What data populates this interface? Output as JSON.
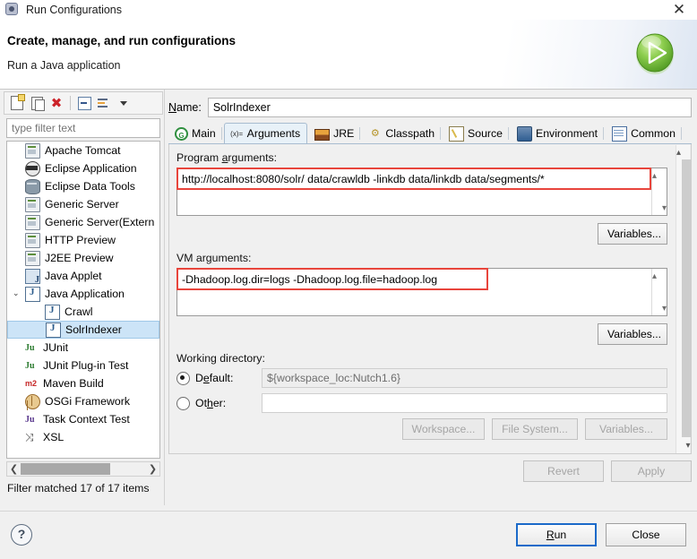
{
  "window": {
    "title": "Run Configurations",
    "icon": "run-configurations-icon",
    "close_label": "✕"
  },
  "header": {
    "title": "Create, manage, and run configurations",
    "subtitle": "Run a Java application",
    "run_icon": "run-play-icon"
  },
  "tree_toolbar": {
    "buttons": [
      {
        "name": "new-launch-configuration-button",
        "icon": "new-document-icon"
      },
      {
        "name": "duplicate-launch-configuration-button",
        "icon": "copy-icon"
      },
      {
        "name": "delete-launch-configuration-button",
        "icon": "delete-x-icon",
        "glyph": "✖"
      },
      {
        "name": "collapse-all-button",
        "icon": "collapse-all-icon"
      },
      {
        "name": "filter-launch-configurations-button",
        "icon": "filter-icon"
      },
      {
        "name": "view-menu-button",
        "icon": "chevron-down-icon"
      }
    ]
  },
  "filter": {
    "placeholder": "type filter text",
    "value": "",
    "status": "Filter matched 17 of 17 items"
  },
  "tree": {
    "items": [
      {
        "label": "Apache Tomcat",
        "icon": "server-icon",
        "indent": 0,
        "selected": false,
        "twisty": ""
      },
      {
        "label": "Eclipse Application",
        "icon": "eclipse-icon",
        "indent": 0,
        "selected": false,
        "twisty": ""
      },
      {
        "label": "Eclipse Data Tools",
        "icon": "database-icon",
        "indent": 0,
        "selected": false,
        "twisty": ""
      },
      {
        "label": "Generic Server",
        "icon": "server-icon",
        "indent": 0,
        "selected": false,
        "twisty": ""
      },
      {
        "label": "Generic Server(Extern",
        "icon": "server-icon",
        "indent": 0,
        "selected": false,
        "twisty": ""
      },
      {
        "label": "HTTP Preview",
        "icon": "server-icon",
        "indent": 0,
        "selected": false,
        "twisty": ""
      },
      {
        "label": "J2EE Preview",
        "icon": "server-icon",
        "indent": 0,
        "selected": false,
        "twisty": ""
      },
      {
        "label": "Java Applet",
        "icon": "java-applet-icon",
        "indent": 0,
        "selected": false,
        "twisty": ""
      },
      {
        "label": "Java Application",
        "icon": "java-application-icon",
        "indent": 0,
        "selected": false,
        "twisty": "⌄"
      },
      {
        "label": "Crawl",
        "icon": "java-application-icon",
        "indent": 1,
        "selected": false,
        "twisty": ""
      },
      {
        "label": "SolrIndexer",
        "icon": "java-application-icon",
        "indent": 1,
        "selected": true,
        "twisty": ""
      },
      {
        "label": "JUnit",
        "icon": "junit-icon",
        "indent": 0,
        "selected": false,
        "twisty": ""
      },
      {
        "label": "JUnit Plug-in Test",
        "icon": "junit-plugin-icon",
        "indent": 0,
        "selected": false,
        "twisty": ""
      },
      {
        "label": "Maven Build",
        "icon": "maven-icon",
        "indent": 0,
        "selected": false,
        "twisty": ""
      },
      {
        "label": "OSGi Framework",
        "icon": "osgi-icon",
        "indent": 0,
        "selected": false,
        "twisty": ""
      },
      {
        "label": "Task Context Test",
        "icon": "task-context-icon",
        "indent": 0,
        "selected": false,
        "twisty": ""
      },
      {
        "label": "XSL",
        "icon": "xsl-icon",
        "indent": 0,
        "selected": false,
        "twisty": ""
      }
    ]
  },
  "config": {
    "name_label": "Name:",
    "name_value": "SolrIndexer",
    "tabs": [
      {
        "label": "Main",
        "icon": "main-tab-icon",
        "active": false
      },
      {
        "label": "Arguments",
        "icon": "arguments-tab-icon",
        "active": true
      },
      {
        "label": "JRE",
        "icon": "jre-tab-icon",
        "active": false
      },
      {
        "label": "Classpath",
        "icon": "classpath-tab-icon",
        "active": false
      },
      {
        "label": "Source",
        "icon": "source-tab-icon",
        "active": false
      },
      {
        "label": "Environment",
        "icon": "environment-tab-icon",
        "active": false
      },
      {
        "label": "Common",
        "icon": "common-tab-icon",
        "active": false
      }
    ],
    "program_arguments": {
      "label": "Program arguments:",
      "value": "http://localhost:8080/solr/ data/crawldb -linkdb data/linkdb data/segments/*",
      "variables_button": "Variables...",
      "highlighted": true
    },
    "vm_arguments": {
      "label": "VM arguments:",
      "value": "-Dhadoop.log.dir=logs -Dhadoop.log.file=hadoop.log",
      "variables_button": "Variables...",
      "highlighted": true
    },
    "working_directory": {
      "label": "Working directory:",
      "default_label": "Default:",
      "default_value": "${workspace_loc:Nutch1.6}",
      "default_selected": true,
      "other_label": "Other:",
      "other_value": "",
      "other_selected": false,
      "workspace_button": "Workspace...",
      "file_system_button": "File System...",
      "variables_button": "Variables..."
    },
    "revert_button": "Revert",
    "apply_button": "Apply"
  },
  "footer": {
    "help_glyph": "?",
    "run_button": "Run",
    "close_button": "Close"
  },
  "colors": {
    "highlight_red": "#e8453c",
    "selection_blue": "#cce4f7",
    "focus_blue": "#1b6ac9",
    "panel_gray": "#f0f0f0",
    "run_green": "#5bb02c"
  }
}
